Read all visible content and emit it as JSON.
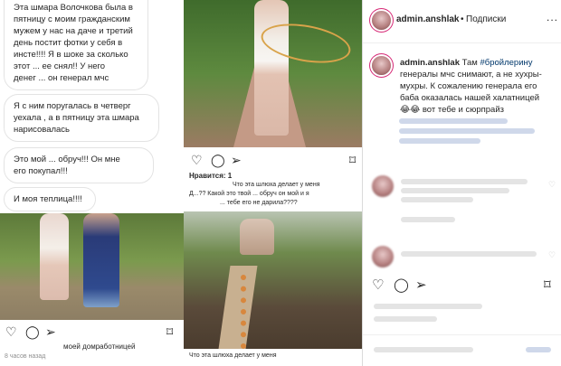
{
  "panel_left": {
    "messages": [
      [
        "Эта шмара Волочкова была в",
        "пятницу с моим гражданским",
        "мужем у нас на даче и третий",
        "день постит фотки у себя в",
        "инсте!!!! Я в шоке за сколько",
        "этот ... ее снял!! У него",
        "денег ... он генерал мчс"
      ],
      [
        "Я с ним поругалась в четверг",
        "уехала , а в пятницу эта шмара",
        "нарисовалась"
      ],
      [
        "Это мой ... обруч!!! Он мне",
        "его покупал!!!"
      ],
      [
        "И моя теплица!!!!"
      ]
    ],
    "caption_user": "моей домработницей",
    "time": "8 часов назад"
  },
  "panel_middle": {
    "likes": "Нравится: 1",
    "comment_lines": [
      "Что эта шлюха делает у меня",
      "Д...?? Какой это твой ... обруч он мой и я",
      "... тебе его не дарила????"
    ],
    "caption_bottom": "Что эта шлюха делает у меня"
  },
  "panel_right": {
    "header": {
      "username": "admin.anshlak",
      "separator": "•",
      "follow": "Подписки",
      "more": "..."
    },
    "post": {
      "username": "admin.anshlak",
      "line1_pre": "Там",
      "hashtag": "#бройлерину",
      "lines": [
        "генералы мчс снимают, а не хухры-",
        "мухры. К сожалению генерала его",
        "баба оказалась нашей халатницей",
        "😂😂 вот тебе и сюрпрайз"
      ]
    }
  },
  "colors": {
    "text": "#262626",
    "muted": "#8e8e8e",
    "hashtag": "#00376b",
    "border": "#dbdbdb",
    "story_ring": "#d62976"
  }
}
